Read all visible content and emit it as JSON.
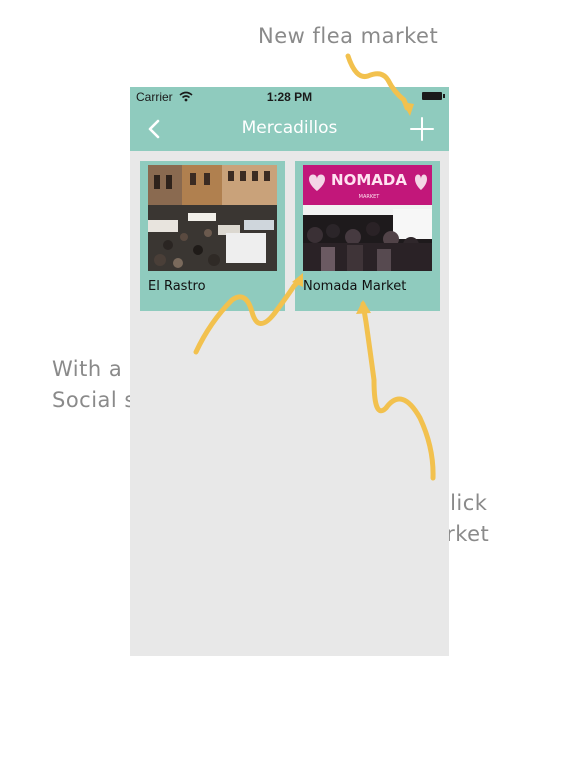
{
  "annotations": {
    "new_flea_market": "New flea market",
    "long_click_line1": "With a long click",
    "long_click_line2": "Social sharing",
    "short_click_line1": "With a short click",
    "short_click_line2": "Go to flea market"
  },
  "status_bar": {
    "carrier": "Carrier",
    "time": "1:28 PM"
  },
  "nav_bar": {
    "title": "Mercadillos",
    "back_icon": "chevron-left-icon",
    "add_icon": "plus-icon"
  },
  "markets": [
    {
      "name": "El Rastro"
    },
    {
      "name": "Nomada Market",
      "banner_text": "NOMADA",
      "banner_sub": "MARKET"
    }
  ],
  "colors": {
    "accent": "#8fcbbe",
    "arrow": "#f2c14e",
    "annotation_text": "#8a8a8a",
    "background": "#e8e8e8",
    "banner": "#c2177a"
  }
}
